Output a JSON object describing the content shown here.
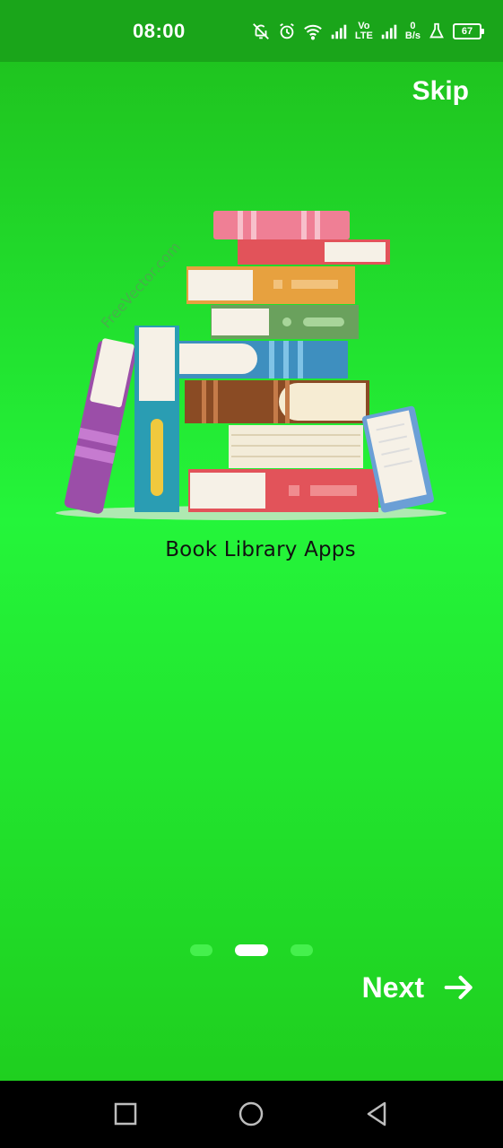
{
  "status_bar": {
    "time": "08:00",
    "network_type": "Vo LTE",
    "network_type_top": "Vo",
    "network_type_bottom": "LTE",
    "speed_value": "0",
    "speed_unit": "B/s",
    "battery_level": "67",
    "icons": [
      "notifications-off-icon",
      "alarm-icon",
      "wifi-icon",
      "signal-icon",
      "lte-signal-icon",
      "lab-icon",
      "battery-icon"
    ]
  },
  "onboarding": {
    "skip_label": "Skip",
    "illustration_caption": "Book Library Apps",
    "watermark": "FreeVector.com",
    "next_label": "Next",
    "page_count": 3,
    "active_page": 2
  },
  "colors": {
    "background": "#1fd21f",
    "status_bar": "#1aa51a",
    "active_dot": "#ffffff",
    "inactive_dot": "#45f04d"
  },
  "nav_bar": {
    "buttons": [
      "recents-button",
      "home-button",
      "back-button"
    ]
  }
}
